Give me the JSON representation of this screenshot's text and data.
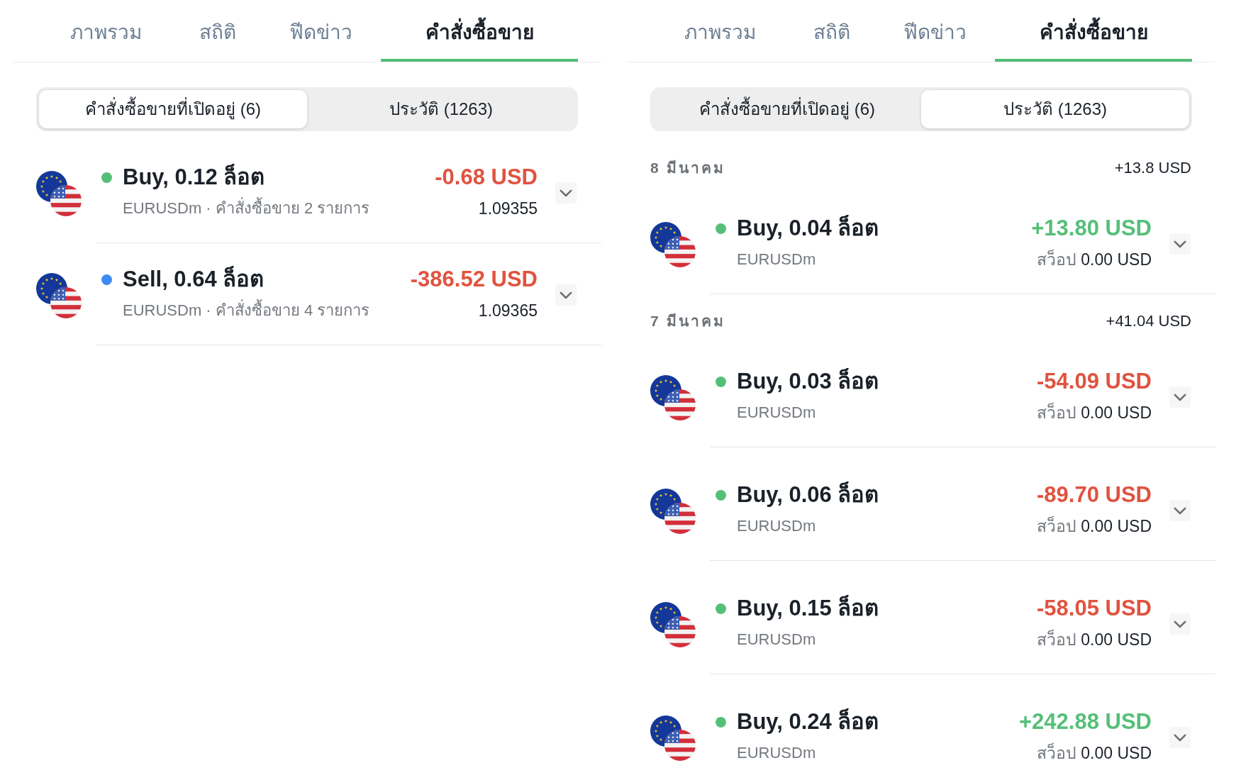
{
  "panels": [
    {
      "tabs": [
        {
          "label": "ภาพรวม",
          "selected": false
        },
        {
          "label": "สถิติ",
          "selected": false
        },
        {
          "label": "ฟีดข่าว",
          "selected": false
        },
        {
          "label": "คำสั่งซื้อขาย",
          "selected": true
        }
      ],
      "segments": [
        {
          "label": "คำสั่งซื้อขายที่เปิดอยู่ (6)",
          "selected": true
        },
        {
          "label": "ประวัติ (1263)",
          "selected": false
        }
      ],
      "orders": [
        {
          "color": "#55bf78",
          "title": "Buy, 0.12 ล็อต",
          "subtitle": "EURUSDm · คำสั่งซื้อขาย 2 รายการ",
          "amount": "-0.68 USD",
          "profit": false,
          "price": "1.09355",
          "expanded": false
        },
        {
          "color": "#3d8bf2",
          "title": "Sell, 0.64 ล็อต",
          "subtitle": "EURUSDm · คำสั่งซื้อขาย 4 รายการ",
          "amount": "-386.52 USD",
          "profit": false,
          "price": "1.09365",
          "expanded": false
        }
      ]
    },
    {
      "tabs": [
        {
          "label": "ภาพรวม",
          "selected": false
        },
        {
          "label": "สถิติ",
          "selected": false
        },
        {
          "label": "ฟีดข่าว",
          "selected": false
        },
        {
          "label": "คำสั่งซื้อขาย",
          "selected": true
        }
      ],
      "segments": [
        {
          "label": "คำสั่งซื้อขายที่เปิดอยู่ (6)",
          "selected": false
        },
        {
          "label": "ประวัติ (1263)",
          "selected": true
        }
      ],
      "groups": [
        {
          "date": "8 มีนาคม",
          "total": "+13.8 USD",
          "orders": [
            {
              "color": "#55bf78",
              "title": "Buy, 0.04 ล็อต",
              "subtitle": "EURUSDm",
              "amount": "+13.80 USD",
              "profit": true,
              "swap_label": "สว็อป",
              "swap": "0.00 USD",
              "expanded": false
            }
          ]
        },
        {
          "date": "7 มีนาคม",
          "total": "+41.04 USD",
          "orders": [
            {
              "color": "#55bf78",
              "title": "Buy, 0.03 ล็อต",
              "subtitle": "EURUSDm",
              "amount": "-54.09 USD",
              "profit": false,
              "swap_label": "สว็อป",
              "swap": "0.00 USD",
              "expanded": false
            },
            {
              "color": "#55bf78",
              "title": "Buy, 0.06 ล็อต",
              "subtitle": "EURUSDm",
              "amount": "-89.70 USD",
              "profit": false,
              "swap_label": "สว็อป",
              "swap": "0.00 USD",
              "expanded": false
            },
            {
              "color": "#55bf78",
              "title": "Buy, 0.15 ล็อต",
              "subtitle": "EURUSDm",
              "amount": "-58.05 USD",
              "profit": false,
              "swap_label": "สว็อป",
              "swap": "0.00 USD",
              "expanded": false
            },
            {
              "color": "#55bf78",
              "title": "Buy, 0.24 ล็อต",
              "subtitle": "EURUSDm",
              "amount": "+242.88 USD",
              "profit": true,
              "swap_label": "สว็อป",
              "swap": "0.00 USD",
              "expanded": false
            }
          ]
        }
      ]
    }
  ]
}
